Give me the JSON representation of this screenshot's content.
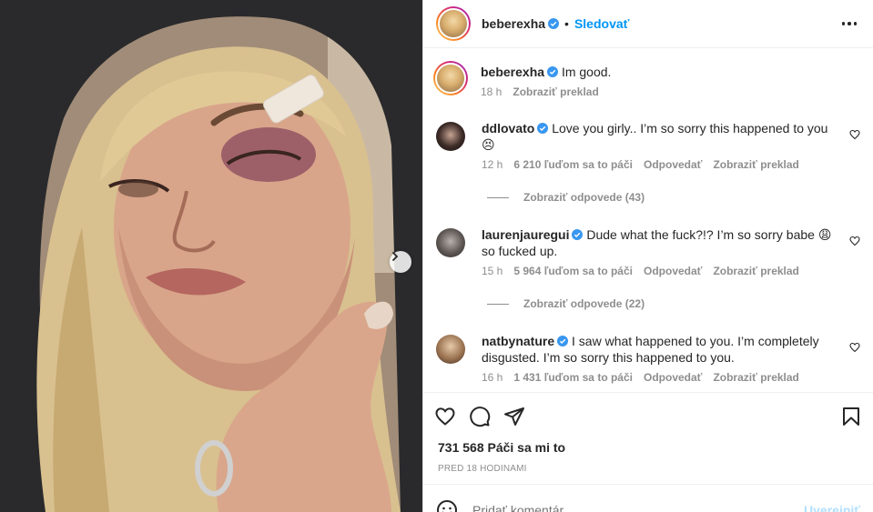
{
  "post": {
    "author": "beberexha",
    "follow_label": "Sledovať",
    "caption": "Im good.",
    "caption_time": "18 h",
    "caption_translate": "Zobraziť preklad"
  },
  "comments": [
    {
      "user": "ddlovato",
      "text": "Love you girly.. I’m so sorry this happened to you 😣",
      "time": "12 h",
      "likes": "6 210 ľuďom sa to páči",
      "reply": "Odpovedať",
      "translate": "Zobraziť preklad",
      "replies_label": "Zobraziť odpovede (43)"
    },
    {
      "user": "laurenjauregui",
      "text": "Dude what the fuck?!? I’m so sorry babe 😩 so fucked up.",
      "time": "15 h",
      "likes": "5 964 ľuďom sa to páči",
      "reply": "Odpovedať",
      "translate": "Zobraziť preklad",
      "replies_label": "Zobraziť odpovede (22)"
    },
    {
      "user": "natbynature",
      "text": "I saw what happened to you. I’m completely disgusted. I’m so sorry this happened to you.",
      "time": "16 h",
      "likes": "1 431 ľuďom sa to páči",
      "reply": "Odpovedať",
      "translate": "Zobraziť preklad"
    }
  ],
  "actions": {
    "likes": "731 568 Páči sa mi to",
    "posted": "PRED 18 HODINAMI"
  },
  "composer": {
    "placeholder": "Pridať komentár...",
    "post_label": "Uverejniť"
  },
  "icons": [
    "heart-icon",
    "comment-icon",
    "share-icon",
    "bookmark-icon",
    "emoji-icon",
    "more-icon",
    "verified-icon",
    "chevron-right-icon"
  ],
  "colors": {
    "accent": "#0095f6",
    "verified": "#3897f0",
    "muted": "#8e8e8e",
    "post_disabled": "#b2dffc"
  }
}
